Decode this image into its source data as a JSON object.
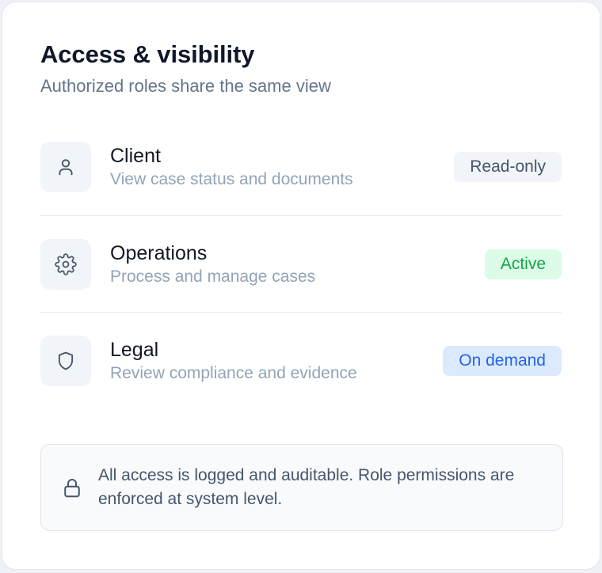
{
  "header": {
    "title": "Access & visibility",
    "subtitle": "Authorized roles share the same view"
  },
  "roles": [
    {
      "name": "Client",
      "description": "View case status and documents",
      "badge": "Read-only",
      "icon": "user-icon",
      "badge_color": "#475569"
    },
    {
      "name": "Operations",
      "description": "Process and manage cases",
      "badge": "Active",
      "icon": "gear-icon",
      "badge_color": "#16a34a"
    },
    {
      "name": "Legal",
      "description": "Review compliance and evidence",
      "badge": "On demand",
      "icon": "shield-icon",
      "badge_color": "#2563eb"
    }
  ],
  "notice": {
    "icon": "lock-icon",
    "text": "All access is logged and auditable. Role permissions are enforced at system level."
  }
}
